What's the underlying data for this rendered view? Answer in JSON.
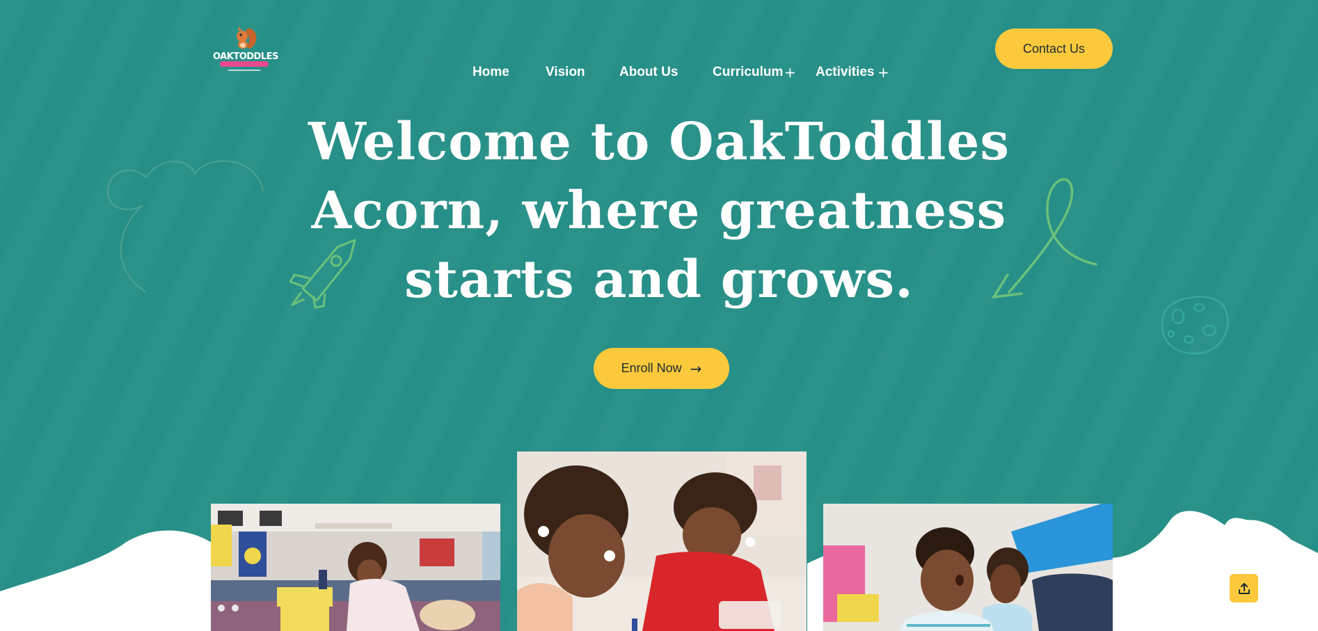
{
  "brand": {
    "logo_text": "OAKTODDLES",
    "logo_alt": "OakToddles Acorn logo"
  },
  "nav": {
    "items": [
      {
        "label": "Home",
        "has_submenu": false
      },
      {
        "label": "Vision",
        "has_submenu": false
      },
      {
        "label": "About Us",
        "has_submenu": false
      },
      {
        "label": "Curriculum",
        "has_submenu": true
      },
      {
        "label": "Activities",
        "has_submenu": true
      }
    ],
    "submenu_icon": "plus-icon"
  },
  "header": {
    "contact_label": "Contact Us"
  },
  "hero": {
    "headline_line1": "Welcome to OakToddles",
    "headline_line2": "Acorn, where greatness",
    "headline_line3": "starts and grows.",
    "enroll_label": "Enroll Now",
    "enroll_icon": "arrow-right-icon"
  },
  "photos": [
    {
      "name": "child-playing-blocks-photo"
    },
    {
      "name": "children-drawing-photo"
    },
    {
      "name": "children-listening-photo"
    }
  ],
  "colors": {
    "hero_bg": "#268f87",
    "accent": "#fcc93c",
    "text_dark": "#1c2b33",
    "doodle_green": "#6cc07a",
    "logo_pink": "#e84a8f"
  },
  "scroll_top_icon": "upload-icon"
}
